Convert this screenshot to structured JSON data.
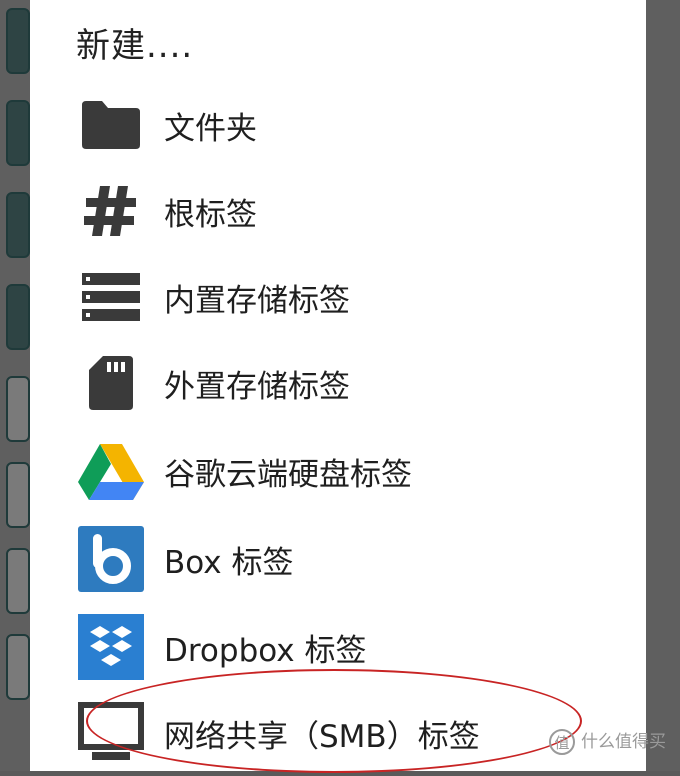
{
  "dialog": {
    "title": "新建....",
    "items": [
      {
        "label": "文件夹",
        "icon": "folder-icon"
      },
      {
        "label": "根标签",
        "icon": "hash-icon"
      },
      {
        "label": "内置存储标签",
        "icon": "internal-storage-icon"
      },
      {
        "label": "外置存储标签",
        "icon": "sd-card-icon"
      },
      {
        "label": "谷歌云端硬盘标签",
        "icon": "google-drive-icon"
      },
      {
        "label": "Box 标签",
        "icon": "box-icon"
      },
      {
        "label": "Dropbox 标签",
        "icon": "dropbox-icon"
      },
      {
        "label": "网络共享（SMB）标签",
        "icon": "monitor-icon"
      }
    ]
  },
  "annotation": {
    "color": "#c82424"
  },
  "watermark": {
    "text": "什么值得买",
    "symbol": "值"
  },
  "colors": {
    "icon_dark": "#3a3a3a",
    "drive_green": "#0f9d58",
    "drive_yellow": "#f4b400",
    "drive_blue": "#4285f4",
    "box_blue": "#2e7bbf",
    "dropbox_blue": "#2a7fd1"
  }
}
